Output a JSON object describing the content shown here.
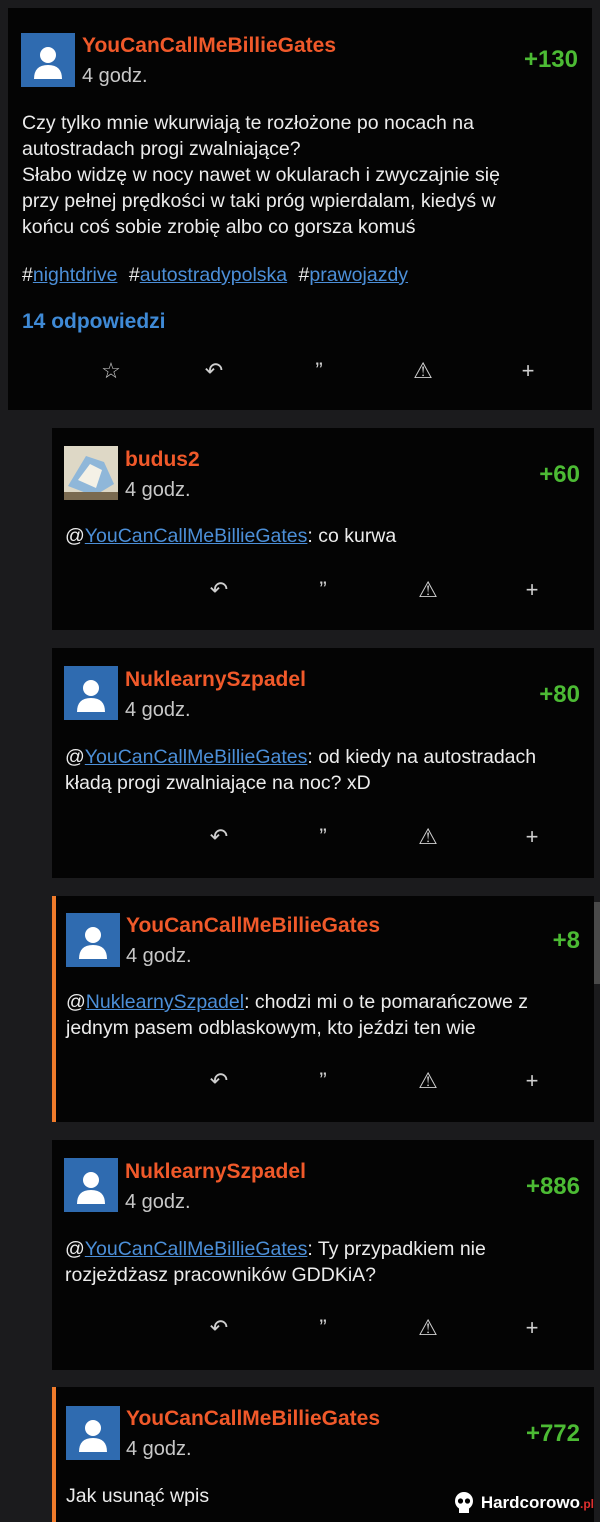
{
  "post": {
    "author": "YouCanCallMeBillieGates",
    "time": "4 godz.",
    "votes": "+130",
    "text_lines": [
      "Czy tylko mnie wkurwiają te rozłożone po nocach na",
      "autostradach progi zwalniające?",
      "Słabo widzę w nocy nawet w okularach i zwyczajnie się",
      "przy pełnej prędkości w taki próg wpierdalam, kiedyś w",
      "końcu coś sobie zrobię albo co gorsza komuś"
    ],
    "tags": [
      "nightdrive",
      "autostradypolska",
      "prawojazdy"
    ],
    "hash": "#",
    "replies": "14 odpowiedzi"
  },
  "comments": [
    {
      "author": "budus2",
      "time": "4 godz.",
      "votes": "+60",
      "mention": "YouCanCallMeBillieGates",
      "text_lines": [
        ": co kurwa"
      ]
    },
    {
      "author": "NuklearnySzpadel",
      "time": "4 godz.",
      "votes": "+80",
      "mention": "YouCanCallMeBillieGates",
      "text_lines": [
        ": od kiedy na autostradach",
        "kładą progi zwalniające na noc? xD"
      ]
    },
    {
      "author": "YouCanCallMeBillieGates",
      "time": "4 godz.",
      "votes": "+8",
      "mention": "NuklearnySzpadel",
      "text_lines": [
        ": chodzi mi o te pomarańczowe z",
        "jednym pasem odblaskowym, kto jeździ ten wie"
      ]
    },
    {
      "author": "NuklearnySzpadel",
      "time": "4 godz.",
      "votes": "+886",
      "mention": "YouCanCallMeBillieGates",
      "text_lines": [
        ": Ty przypadkiem nie",
        "rozjeżdżasz pracowników GDDKiA?"
      ]
    },
    {
      "author": "YouCanCallMeBillieGates",
      "time": "4 godz.",
      "votes": "+772",
      "text_lines": [
        "Jak usunąć wpis"
      ]
    }
  ],
  "at": "@",
  "icons": {
    "favorite": "☆",
    "reply": "↶",
    "quote": "”",
    "report": "⚠",
    "more": "+"
  },
  "icon_names": [
    "star-icon",
    "reply-icon",
    "quote-icon",
    "warning-icon",
    "plus-icon"
  ],
  "watermark": {
    "name": "Hardcorowo",
    "suffix": ".pl"
  },
  "colors": {
    "author": "#f0592a",
    "votes": "#4cbb34",
    "link": "#4c8fd8",
    "replies": "#3f8ad6",
    "op_border": "#f07b2b",
    "card": "#040404",
    "page": "#1b1b1d"
  }
}
